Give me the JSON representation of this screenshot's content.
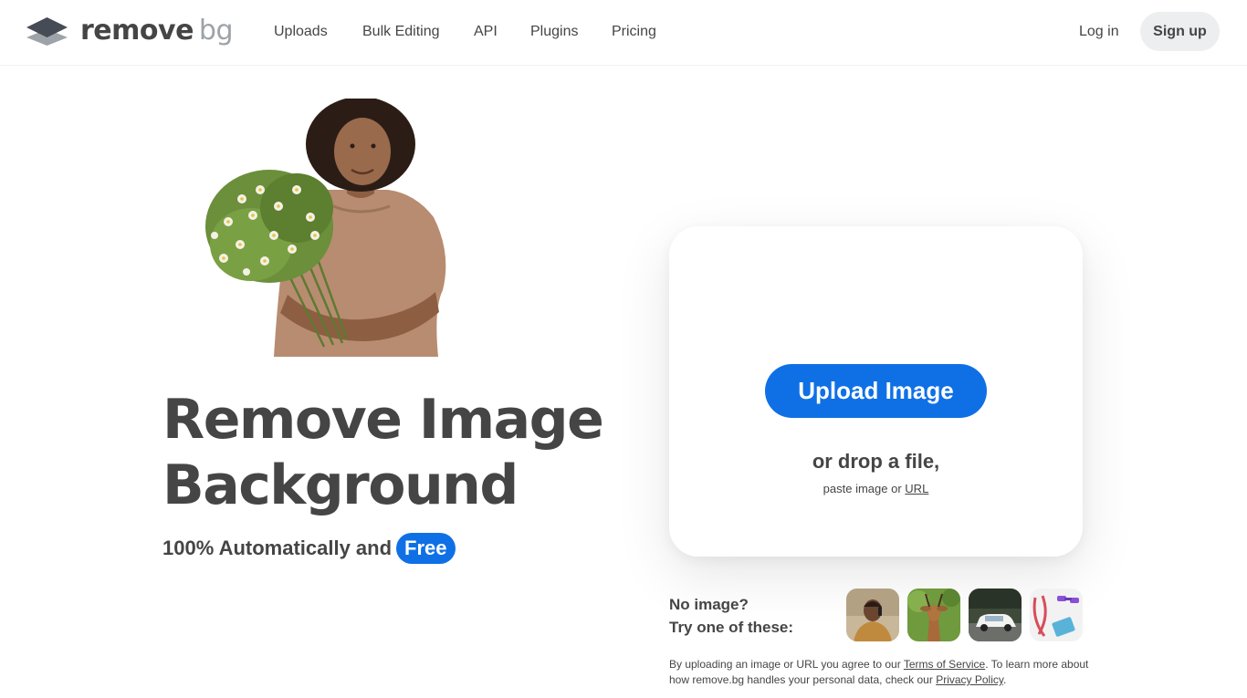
{
  "header": {
    "logo": {
      "primary": "remove",
      "secondary": "bg",
      "icon": "layers-logo-icon"
    },
    "nav": [
      {
        "label": "Uploads"
      },
      {
        "label": "Bulk Editing"
      },
      {
        "label": "API"
      },
      {
        "label": "Plugins"
      },
      {
        "label": "Pricing"
      }
    ],
    "login_label": "Log in",
    "signup_label": "Sign up"
  },
  "hero": {
    "title_line1": "Remove Image",
    "title_line2": "Background",
    "subtitle": "100% Automatically and",
    "badge": "Free"
  },
  "upload": {
    "button_label": "Upload Image",
    "drop_text": "or drop a file,",
    "paste_prefix": "paste image or",
    "paste_link": "URL"
  },
  "samples": {
    "line1": "No image?",
    "line2": "Try one of these:",
    "items": [
      "sample-person-photo",
      "sample-deer-photo",
      "sample-car-photo",
      "sample-fitness-items-photo"
    ]
  },
  "disclaimer": {
    "part1": "By uploading an image or URL you agree to our",
    "terms": "Terms of Service",
    "part2": ". To learn more about how remove.bg handles your personal data, check our",
    "privacy": "Privacy Policy",
    "part3": "."
  },
  "colors": {
    "brand_blue": "#0f70e6",
    "text": "#454545",
    "logo_secondary": "#9da3a8",
    "signup_bg": "#eceef0"
  }
}
